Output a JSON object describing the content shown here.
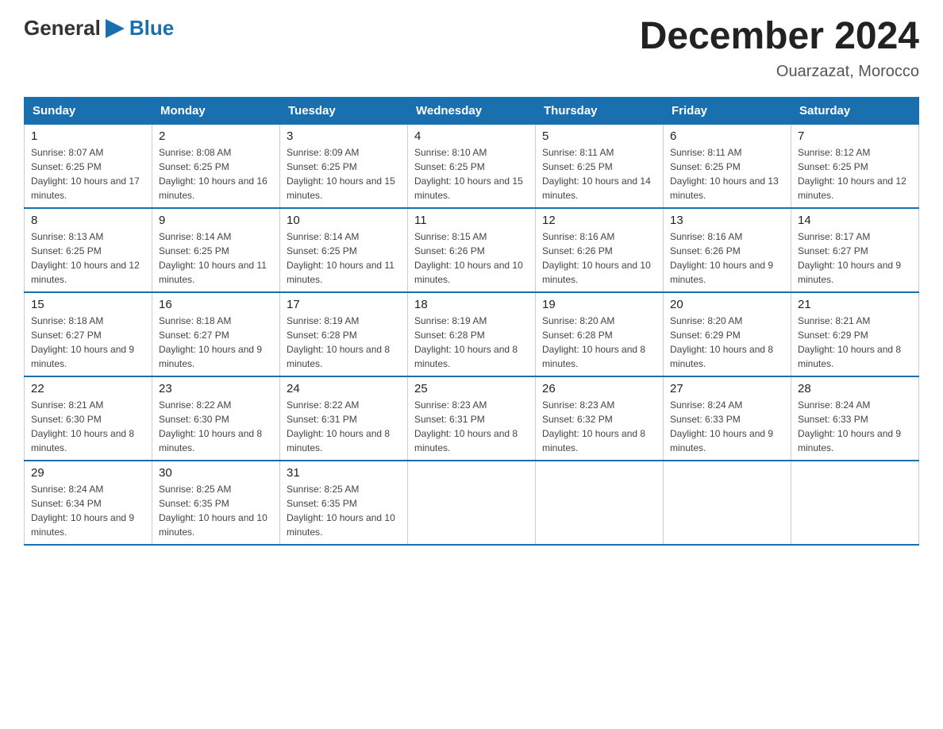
{
  "logo": {
    "general": "General",
    "triangle_icon": "▶",
    "blue": "Blue"
  },
  "title": "December 2024",
  "subtitle": "Ouarzazat, Morocco",
  "weekdays": [
    "Sunday",
    "Monday",
    "Tuesday",
    "Wednesday",
    "Thursday",
    "Friday",
    "Saturday"
  ],
  "weeks": [
    [
      {
        "day": "1",
        "sunrise": "8:07 AM",
        "sunset": "6:25 PM",
        "daylight": "10 hours and 17 minutes."
      },
      {
        "day": "2",
        "sunrise": "8:08 AM",
        "sunset": "6:25 PM",
        "daylight": "10 hours and 16 minutes."
      },
      {
        "day": "3",
        "sunrise": "8:09 AM",
        "sunset": "6:25 PM",
        "daylight": "10 hours and 15 minutes."
      },
      {
        "day": "4",
        "sunrise": "8:10 AM",
        "sunset": "6:25 PM",
        "daylight": "10 hours and 15 minutes."
      },
      {
        "day": "5",
        "sunrise": "8:11 AM",
        "sunset": "6:25 PM",
        "daylight": "10 hours and 14 minutes."
      },
      {
        "day": "6",
        "sunrise": "8:11 AM",
        "sunset": "6:25 PM",
        "daylight": "10 hours and 13 minutes."
      },
      {
        "day": "7",
        "sunrise": "8:12 AM",
        "sunset": "6:25 PM",
        "daylight": "10 hours and 12 minutes."
      }
    ],
    [
      {
        "day": "8",
        "sunrise": "8:13 AM",
        "sunset": "6:25 PM",
        "daylight": "10 hours and 12 minutes."
      },
      {
        "day": "9",
        "sunrise": "8:14 AM",
        "sunset": "6:25 PM",
        "daylight": "10 hours and 11 minutes."
      },
      {
        "day": "10",
        "sunrise": "8:14 AM",
        "sunset": "6:25 PM",
        "daylight": "10 hours and 11 minutes."
      },
      {
        "day": "11",
        "sunrise": "8:15 AM",
        "sunset": "6:26 PM",
        "daylight": "10 hours and 10 minutes."
      },
      {
        "day": "12",
        "sunrise": "8:16 AM",
        "sunset": "6:26 PM",
        "daylight": "10 hours and 10 minutes."
      },
      {
        "day": "13",
        "sunrise": "8:16 AM",
        "sunset": "6:26 PM",
        "daylight": "10 hours and 9 minutes."
      },
      {
        "day": "14",
        "sunrise": "8:17 AM",
        "sunset": "6:27 PM",
        "daylight": "10 hours and 9 minutes."
      }
    ],
    [
      {
        "day": "15",
        "sunrise": "8:18 AM",
        "sunset": "6:27 PM",
        "daylight": "10 hours and 9 minutes."
      },
      {
        "day": "16",
        "sunrise": "8:18 AM",
        "sunset": "6:27 PM",
        "daylight": "10 hours and 9 minutes."
      },
      {
        "day": "17",
        "sunrise": "8:19 AM",
        "sunset": "6:28 PM",
        "daylight": "10 hours and 8 minutes."
      },
      {
        "day": "18",
        "sunrise": "8:19 AM",
        "sunset": "6:28 PM",
        "daylight": "10 hours and 8 minutes."
      },
      {
        "day": "19",
        "sunrise": "8:20 AM",
        "sunset": "6:28 PM",
        "daylight": "10 hours and 8 minutes."
      },
      {
        "day": "20",
        "sunrise": "8:20 AM",
        "sunset": "6:29 PM",
        "daylight": "10 hours and 8 minutes."
      },
      {
        "day": "21",
        "sunrise": "8:21 AM",
        "sunset": "6:29 PM",
        "daylight": "10 hours and 8 minutes."
      }
    ],
    [
      {
        "day": "22",
        "sunrise": "8:21 AM",
        "sunset": "6:30 PM",
        "daylight": "10 hours and 8 minutes."
      },
      {
        "day": "23",
        "sunrise": "8:22 AM",
        "sunset": "6:30 PM",
        "daylight": "10 hours and 8 minutes."
      },
      {
        "day": "24",
        "sunrise": "8:22 AM",
        "sunset": "6:31 PM",
        "daylight": "10 hours and 8 minutes."
      },
      {
        "day": "25",
        "sunrise": "8:23 AM",
        "sunset": "6:31 PM",
        "daylight": "10 hours and 8 minutes."
      },
      {
        "day": "26",
        "sunrise": "8:23 AM",
        "sunset": "6:32 PM",
        "daylight": "10 hours and 8 minutes."
      },
      {
        "day": "27",
        "sunrise": "8:24 AM",
        "sunset": "6:33 PM",
        "daylight": "10 hours and 9 minutes."
      },
      {
        "day": "28",
        "sunrise": "8:24 AM",
        "sunset": "6:33 PM",
        "daylight": "10 hours and 9 minutes."
      }
    ],
    [
      {
        "day": "29",
        "sunrise": "8:24 AM",
        "sunset": "6:34 PM",
        "daylight": "10 hours and 9 minutes."
      },
      {
        "day": "30",
        "sunrise": "8:25 AM",
        "sunset": "6:35 PM",
        "daylight": "10 hours and 10 minutes."
      },
      {
        "day": "31",
        "sunrise": "8:25 AM",
        "sunset": "6:35 PM",
        "daylight": "10 hours and 10 minutes."
      },
      null,
      null,
      null,
      null
    ]
  ]
}
